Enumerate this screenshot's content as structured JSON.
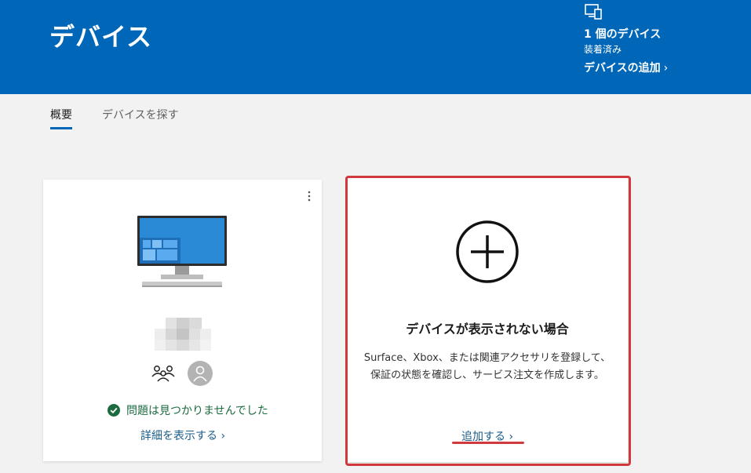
{
  "header": {
    "title": "デバイス",
    "device_count": "1 個のデバイス",
    "device_status": "装着済み",
    "add_device_link": "デバイスの追加",
    "add_device_chevron": "›"
  },
  "tabs": [
    {
      "label": "概要",
      "active": true
    },
    {
      "label": "デバイスを探す",
      "active": false
    }
  ],
  "device_card": {
    "more_icon": "more-options-icon",
    "device_icon": "desktop-monitor-icon",
    "status_text": "問題は見つかりませんでした",
    "details_link": "詳細を表示する",
    "details_chevron": "›"
  },
  "add_card": {
    "icon": "plus-circle-icon",
    "title": "デバイスが表示されない場合",
    "description_line1": "Surface、Xbox、または関連アクセサリを登録して、",
    "description_line2": "保証の状態を確認し、サービス注文を作成します。",
    "add_link": "追加する",
    "add_chevron": "›"
  },
  "colors": {
    "header_bg": "#0067b8",
    "page_bg": "#f2f2f2",
    "success": "#1b6b3f",
    "link": "#1a5c8a",
    "annotation": "#d0393e"
  }
}
